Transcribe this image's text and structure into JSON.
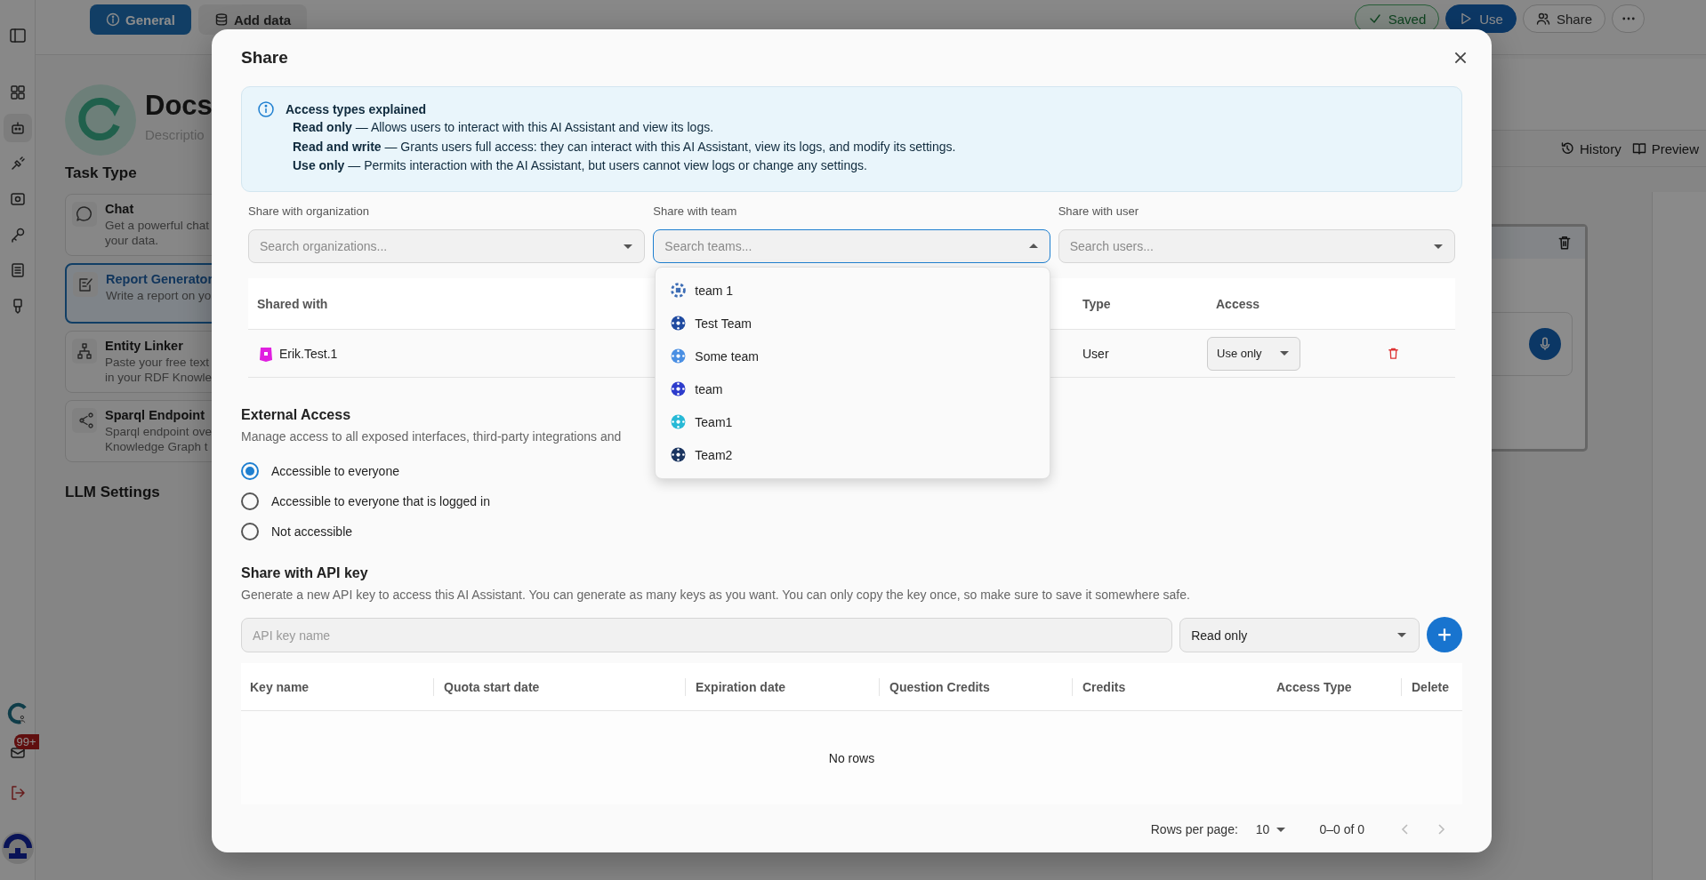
{
  "background": {
    "notifications_badge": "99+",
    "tabs": [
      {
        "label": "General",
        "selected": true
      },
      {
        "label": "Add data",
        "selected": false
      }
    ],
    "header_actions": [
      {
        "kind": "status",
        "label": "Saved"
      },
      {
        "kind": "primary",
        "label": "Use"
      },
      {
        "kind": "outline",
        "label": "Share"
      },
      {
        "kind": "more"
      }
    ],
    "title": "Docs",
    "description_placeholder": "Descriptio",
    "task_type": {
      "heading": "Task Type",
      "items": [
        {
          "kind": "chat",
          "title": "Chat",
          "description": "Get a powerful chat\nyour data.",
          "selected": false
        },
        {
          "kind": "report",
          "title": "Report Generator",
          "description": "Write a report on yo",
          "selected": true
        },
        {
          "kind": "linker",
          "title": "Entity Linker",
          "description": "Paste your free text\nin your RDF Knowle",
          "selected": false
        },
        {
          "kind": "sparql",
          "title": "Sparql Endpoint",
          "description": "Sparql endpoint ove\nKnowledge Graph t",
          "selected": false
        }
      ]
    },
    "llm_settings": "LLM Settings",
    "preview_toolbar": [
      {
        "kind": "history",
        "label": "History"
      },
      {
        "kind": "preview",
        "label": "Preview"
      }
    ]
  },
  "dialog": {
    "title": "Share",
    "info": {
      "heading": "Access types explained",
      "lines": [
        "**Read only** — Allows users to interact with this AI Assistant and view its logs.",
        "**Read and write** — Grants users full access: they can interact with this AI Assistant, view its logs, and modify its settings.",
        "**Use only** — Permits interaction with the AI Assistant, but users cannot view logs or change any settings."
      ]
    },
    "pickers": [
      {
        "label": "Share with organization",
        "placeholder": "Search organizations...",
        "open": false
      },
      {
        "label": "Share with team",
        "placeholder": "Search teams...",
        "open": true
      },
      {
        "label": "Share with user",
        "placeholder": "Search users...",
        "open": false
      }
    ],
    "team_options": [
      {
        "label": "team 1",
        "color": "#3d6db5"
      },
      {
        "label": "Test Team",
        "color": "#1f4aa0"
      },
      {
        "label": "Some team",
        "color": "#4a8fe3"
      },
      {
        "label": "team",
        "color": "#2d3ccc"
      },
      {
        "label": "Team1",
        "color": "#27b9d6"
      },
      {
        "label": "Team2",
        "color": "#1b3560"
      }
    ],
    "shared_table": {
      "columns": [
        "Shared with",
        "Type",
        "Access"
      ],
      "rows": [
        {
          "name": "Erik.Test.1",
          "type": "User",
          "access": "Use only"
        }
      ]
    },
    "external_access": {
      "heading": "External Access",
      "description": "Manage access to all exposed interfaces, third-party integrations and",
      "options": [
        {
          "label": "Accessible to everyone",
          "selected": true
        },
        {
          "label": "Accessible to everyone that is logged in",
          "selected": false
        },
        {
          "label": "Not accessible",
          "selected": false
        }
      ]
    },
    "api_keys": {
      "heading": "Share with API key",
      "description": "Generate a new API key to access this AI Assistant. You can generate as many keys as you want. You can only copy the key once, so make sure to save it somewhere safe.",
      "name_placeholder": "API key name",
      "access": "Read only",
      "columns": [
        "Key name",
        "Quota start date",
        "Expiration date",
        "Question Credits",
        "Credits",
        "Access Type",
        "Delete"
      ],
      "empty": "No rows",
      "rows_per_page_label": "Rows per page:",
      "rows_per_page": "10",
      "range": "0–0 of 0"
    }
  }
}
